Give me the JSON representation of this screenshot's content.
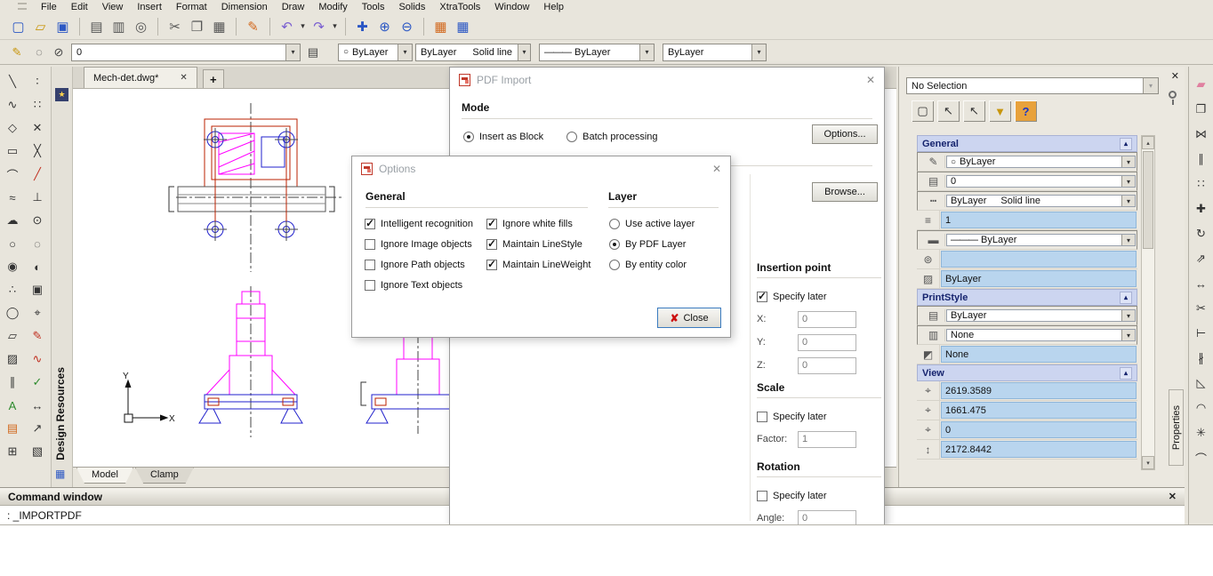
{
  "ui": {
    "dd": "▾",
    "up": "▴",
    "down": "▾",
    "close": "✕",
    "plus": "+"
  },
  "colors": {
    "selection_fill": "#b9d5ee",
    "section_header": "#ccd5f0",
    "magenta": "#ff00ff",
    "blue": "#2222cc",
    "red": "#bb2200"
  },
  "menu": {
    "items": [
      {
        "name": "menu-file",
        "label": "File"
      },
      {
        "name": "menu-edit",
        "label": "Edit"
      },
      {
        "name": "menu-view",
        "label": "View"
      },
      {
        "name": "menu-insert",
        "label": "Insert"
      },
      {
        "name": "menu-format",
        "label": "Format"
      },
      {
        "name": "menu-dimension",
        "label": "Dimension"
      },
      {
        "name": "menu-draw",
        "label": "Draw"
      },
      {
        "name": "menu-modify",
        "label": "Modify"
      },
      {
        "name": "menu-tools",
        "label": "Tools"
      },
      {
        "name": "menu-solids",
        "label": "Solids"
      },
      {
        "name": "menu-xtratools",
        "label": "XtraTools"
      },
      {
        "name": "menu-window",
        "label": "Window"
      },
      {
        "name": "menu-help",
        "label": "Help"
      }
    ]
  },
  "toolbar_main": {
    "icons": [
      {
        "name": "new-file-icon",
        "glyph": "▢",
        "cls": "c-b"
      },
      {
        "name": "open-file-icon",
        "glyph": "▱",
        "cls": "c-y"
      },
      {
        "name": "save-icon",
        "glyph": "▣",
        "cls": "c-b"
      },
      {
        "cls": "sep"
      },
      {
        "name": "print-icon",
        "glyph": "▤",
        "cls": "c-gy"
      },
      {
        "name": "print-preview-icon",
        "glyph": "▥",
        "cls": "c-gy"
      },
      {
        "name": "find-icon",
        "glyph": "◎",
        "cls": "c-gy"
      },
      {
        "cls": "sep"
      },
      {
        "name": "cut-icon",
        "glyph": "✂",
        "cls": "c-gy"
      },
      {
        "name": "copy-icon",
        "glyph": "❐",
        "cls": "c-gy"
      },
      {
        "name": "paste-icon",
        "glyph": "▦",
        "cls": "c-gy"
      },
      {
        "cls": "sep"
      },
      {
        "name": "format-painter-icon",
        "glyph": "✎",
        "cls": "c-o"
      },
      {
        "cls": "sep"
      },
      {
        "name": "undo-icon",
        "glyph": "↶",
        "cls": "c-p"
      },
      {
        "name": "undo-dropdown-icon",
        "glyph": "▾",
        "cls": "dd"
      },
      {
        "name": "redo-icon",
        "glyph": "↷",
        "cls": "c-p"
      },
      {
        "name": "redo-dropdown-icon",
        "glyph": "▾",
        "cls": "dd"
      },
      {
        "cls": "sep"
      },
      {
        "name": "pan-icon",
        "glyph": "✚",
        "cls": "c-b"
      },
      {
        "name": "zoom-in-icon",
        "glyph": "⊕",
        "cls": "c-b"
      },
      {
        "name": "zoom-out-icon",
        "glyph": "⊖",
        "cls": "c-b"
      },
      {
        "cls": "sep"
      },
      {
        "name": "layers-manager-icon",
        "glyph": "▦",
        "cls": "c-o"
      },
      {
        "name": "table-icon",
        "glyph": "▦",
        "cls": "c-b"
      }
    ]
  },
  "toolbar_props": {
    "layer_tool_icon": "✎",
    "pre_icons": [
      {
        "name": "layer-state-icon",
        "glyph": "◌"
      },
      {
        "name": "layer-off-icon",
        "glyph": "⊘"
      }
    ],
    "layer_combo": {
      "value": "0"
    },
    "layers_icon": "▤",
    "color_combo": {
      "swatch": "○",
      "value": "ByLayer"
    },
    "linetype_combo": {
      "value": "ByLayer",
      "value2": "Solid line"
    },
    "lineweight_combo": {
      "prefix": "———",
      "value": "ByLayer"
    },
    "plotstyle_combo": {
      "value": "ByLayer"
    }
  },
  "left_toolbar": {
    "col1": [
      {
        "name": "line-tool-icon",
        "glyph": "╲"
      },
      {
        "name": "polyline-tool-icon",
        "glyph": "∿"
      },
      {
        "name": "polygon-tool-icon",
        "glyph": "◇"
      },
      {
        "name": "rectangle-tool-icon",
        "glyph": "▭"
      },
      {
        "name": "arc-tool-icon",
        "glyph": "⌒"
      },
      {
        "name": "spline-tool-icon",
        "glyph": "≈"
      },
      {
        "name": "revision-cloud-tool-icon",
        "glyph": "☁"
      },
      {
        "name": "circle-tool-icon",
        "glyph": "○"
      },
      {
        "name": "donut-tool-icon",
        "glyph": "◉"
      },
      {
        "name": "point-tool-icon",
        "glyph": "∴"
      },
      {
        "name": "ellipse-tool-icon",
        "glyph": "◯"
      },
      {
        "name": "region-tool-icon",
        "glyph": "▱"
      },
      {
        "name": "hatch-tool-icon",
        "glyph": "▨"
      },
      {
        "name": "multiline-tool-icon",
        "glyph": "∥"
      },
      {
        "name": "text-tool-icon",
        "glyph": "A",
        "cls": "c-g"
      },
      {
        "name": "image-tool-icon",
        "glyph": "▤",
        "cls": "c-o"
      },
      {
        "name": "table-tool-icon",
        "glyph": "⊞"
      }
    ],
    "col2": [
      {
        "name": "divide-tool-icon",
        "glyph": "∶"
      },
      {
        "name": "measure-tool-icon",
        "glyph": "∷"
      },
      {
        "name": "intersection-snap-icon",
        "glyph": "✕"
      },
      {
        "name": "xline-tool-icon",
        "glyph": "╳"
      },
      {
        "name": "ray-tool-icon",
        "glyph": "╱",
        "cls": "c-r"
      },
      {
        "name": "perpendicular-snap-icon",
        "glyph": "⊥"
      },
      {
        "name": "center-snap-icon",
        "glyph": "⊙"
      },
      {
        "name": "node-snap-icon",
        "glyph": "◌"
      },
      {
        "name": "quadrant-snap-icon",
        "glyph": "◐"
      },
      {
        "name": "insert-snap-icon",
        "glyph": "▣"
      },
      {
        "name": "nearest-snap-icon",
        "glyph": "⌖"
      },
      {
        "name": "markup-tool-icon",
        "glyph": "✎",
        "cls": "c-r"
      },
      {
        "name": "sketch-tool-icon",
        "glyph": "∿",
        "cls": "c-r"
      },
      {
        "name": "check-tool-icon",
        "glyph": "✓",
        "cls": "c-g"
      },
      {
        "name": "dimension-tool-icon",
        "glyph": "↔"
      },
      {
        "name": "leader-tool-icon",
        "glyph": "↗"
      },
      {
        "name": "hatch-edit-tool-icon",
        "glyph": "▧"
      }
    ]
  },
  "design_resources": {
    "label": "Design Resources",
    "top_icon": "★",
    "bottom_icon": "▦"
  },
  "doc_tabs": {
    "active_label": "Mech-det.dwg*"
  },
  "canvas": {
    "axis_x": "X",
    "axis_y": "Y"
  },
  "layout_tabs": {
    "items": [
      {
        "name": "tab-model",
        "label": "Model",
        "cls": "active"
      },
      {
        "name": "tab-clamp",
        "label": "Clamp"
      }
    ]
  },
  "command_window": {
    "title": "Command window",
    "prompt": ": _IMPORTPDF"
  },
  "pdf_import_dialog": {
    "title": "PDF Import",
    "mode": {
      "title": "Mode",
      "radios": [
        {
          "name": "radio-insert-as-block",
          "label": "Insert as Block",
          "selected": true
        },
        {
          "name": "radio-batch-processing",
          "label": "Batch processing"
        }
      ]
    },
    "options_button": "Options...",
    "browse_button": "Browse...",
    "insertion": {
      "title": "Insertion point",
      "specify_label": "Specify later",
      "state": "checked",
      "fields": [
        {
          "name": "insertion-x-row",
          "label": "X:",
          "value": "0"
        },
        {
          "name": "insertion-y-row",
          "label": "Y:",
          "value": "0"
        },
        {
          "name": "insertion-z-row",
          "label": "Z:",
          "value": "0"
        }
      ]
    },
    "scale": {
      "title": "Scale",
      "specify_label": "Specify later",
      "state": "unchecked",
      "factor_label": "Factor:",
      "factor_value": "1"
    },
    "rotation": {
      "title": "Rotation",
      "specify_label": "Specify later",
      "state": "unchecked",
      "angle_label": "Angle:",
      "angle_value": "0"
    }
  },
  "options_dialog": {
    "title": "Options",
    "general": {
      "title": "General",
      "col1": [
        {
          "name": "check-intelligent-recognition",
          "label": "Intelligent recognition",
          "checked": true
        },
        {
          "name": "check-ignore-image-objects",
          "label": "Ignore Image objects"
        },
        {
          "name": "check-ignore-path-objects",
          "label": "Ignore Path objects"
        },
        {
          "name": "check-ignore-text-objects",
          "label": "Ignore Text objects"
        }
      ],
      "col2": [
        {
          "name": "check-ignore-white-fills",
          "label": "Ignore white fills",
          "checked": true
        },
        {
          "name": "check-maintain-linestyle",
          "label": "Maintain LineStyle",
          "checked": true
        },
        {
          "name": "check-maintain-lineweight",
          "label": "Maintain LineWeight",
          "checked": true
        }
      ]
    },
    "layer": {
      "title": "Layer",
      "radios": [
        {
          "name": "radio-use-active-layer",
          "label": "Use active layer"
        },
        {
          "name": "radio-by-pdf-layer",
          "label": "By PDF Layer",
          "selected": true
        },
        {
          "name": "radio-by-entity-color",
          "label": "By entity color"
        }
      ]
    },
    "close_button": {
      "label": "Close",
      "glyph": "✘"
    }
  },
  "properties_panel": {
    "selection_combo": "No Selection",
    "tools": [
      {
        "name": "select-window-icon",
        "glyph": "▢"
      },
      {
        "name": "select-cursor-icon",
        "glyph": "↖"
      },
      {
        "name": "select-add-icon",
        "glyph": "↖"
      },
      {
        "name": "quick-select-icon",
        "glyph": "▼",
        "cls": "c-y"
      },
      {
        "name": "help-icon",
        "glyph": "?",
        "cls": "c-help"
      }
    ],
    "sections": {
      "general": "General",
      "printstyle": "PrintStyle",
      "view": "View"
    },
    "general_rows": [
      {
        "name": "color-row",
        "icon": "✎",
        "swatch": "○",
        "value": "ByLayer",
        "cls": "combo"
      },
      {
        "name": "layer-row",
        "icon": "▤",
        "value": "0",
        "cls": "combo"
      },
      {
        "name": "linetype-row",
        "icon": "┅",
        "value": "ByLayer",
        "value2": "Solid line",
        "cls": "combo"
      },
      {
        "name": "linetype-scale-row",
        "icon": "≡",
        "value": "1",
        "cls": "cell"
      },
      {
        "name": "lineweight-row",
        "icon": "▬",
        "prefix": "———",
        "value": "ByLayer",
        "cls": "combo"
      },
      {
        "name": "hyperlink-row",
        "icon": "⊚",
        "value": "",
        "cls": "cell"
      },
      {
        "name": "thickness-row",
        "icon": "▨",
        "value": "ByLayer",
        "cls": "cell"
      }
    ],
    "printstyle_rows": [
      {
        "name": "print-style-row",
        "icon": "▤",
        "value": "ByLayer",
        "cls": "combo"
      },
      {
        "name": "print-style-table-row",
        "icon": "▥",
        "value": "None",
        "cls": "combo"
      },
      {
        "name": "print-table-attached-row",
        "icon": "◩",
        "value": "None",
        "cls": "cell"
      }
    ],
    "view_rows": [
      {
        "name": "view-center-x-row",
        "icon": "⌖",
        "value": "2619.3589",
        "cls": "cell"
      },
      {
        "name": "view-center-y-row",
        "icon": "⌖",
        "value": "1661.475",
        "cls": "cell"
      },
      {
        "name": "view-center-z-row",
        "icon": "⌖",
        "value": "0",
        "cls": "cell"
      },
      {
        "name": "view-height-row",
        "icon": "↕",
        "value": "2172.8442",
        "cls": "cell"
      }
    ],
    "tab_label": "Properties"
  },
  "right_toolbar": {
    "icons": [
      {
        "name": "erase-icon",
        "glyph": "▰",
        "cls": "c-pk"
      },
      {
        "name": "copy-object-icon",
        "glyph": "❐"
      },
      {
        "name": "mirror-icon",
        "glyph": "⋈"
      },
      {
        "name": "offset-icon",
        "glyph": "∥"
      },
      {
        "name": "array-icon",
        "glyph": "∷"
      },
      {
        "name": "move-icon",
        "glyph": "✚"
      },
      {
        "name": "rotate-icon",
        "glyph": "↻"
      },
      {
        "name": "scale-icon",
        "glyph": "⇗"
      },
      {
        "name": "stretch-icon",
        "glyph": "↔"
      },
      {
        "name": "trim-icon",
        "glyph": "✂"
      },
      {
        "name": "extend-icon",
        "glyph": "⊢"
      },
      {
        "name": "break-icon",
        "glyph": "∦"
      },
      {
        "name": "chamfer-icon",
        "glyph": "◺"
      },
      {
        "name": "fillet-icon",
        "glyph": "◠"
      },
      {
        "name": "explode-icon",
        "glyph": "✳"
      },
      {
        "name": "join-icon",
        "glyph": "⌒"
      }
    ]
  }
}
